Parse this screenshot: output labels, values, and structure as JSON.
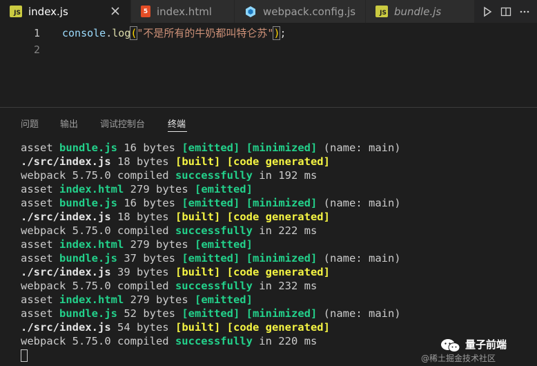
{
  "tabs": [
    {
      "label": "index.js",
      "badge": "JS",
      "badge_bg": "#cbcb41",
      "badge_fg": "#1e1e1e",
      "active": true
    },
    {
      "label": "index.html",
      "badge": "5",
      "badge_bg": "#e44d26",
      "badge_fg": "#ffffff",
      "active": false
    },
    {
      "label": "webpack.config.js",
      "badge": "",
      "badge_bg": "#519aba",
      "badge_fg": "#ffffff",
      "active": false
    },
    {
      "label": "bundle.js",
      "badge": "JS",
      "badge_bg": "#cbcb41",
      "badge_fg": "#1e1e1e",
      "active": false
    }
  ],
  "editor": {
    "lines": [
      {
        "number": "1",
        "obj": "console",
        "dot": ".",
        "fn": "log",
        "open": "(",
        "str": "\"不是所有的牛奶都叫特仑苏\"",
        "close": ")",
        "semi": ";"
      },
      {
        "number": "2"
      }
    ]
  },
  "panel": {
    "tabs": [
      "问题",
      "输出",
      "调试控制台",
      "终端"
    ],
    "active": "终端"
  },
  "terminal": {
    "lines": [
      [
        {
          "t": "asset "
        },
        {
          "t": "bundle.js",
          "c": "green"
        },
        {
          "t": " 16 bytes "
        },
        {
          "t": "[emitted]",
          "c": "green"
        },
        {
          "t": " "
        },
        {
          "t": "[minimized]",
          "c": "green"
        },
        {
          "t": " (name: main)"
        }
      ],
      [
        {
          "t": "./src/index.js",
          "c": "bold"
        },
        {
          "t": " 18 bytes "
        },
        {
          "t": "[built]",
          "c": "yellow"
        },
        {
          "t": " "
        },
        {
          "t": "[code generated]",
          "c": "yellow"
        }
      ],
      [
        {
          "t": "webpack 5.75.0 compiled "
        },
        {
          "t": "successfully",
          "c": "green"
        },
        {
          "t": " in 192 ms"
        }
      ],
      [
        {
          "t": "asset "
        },
        {
          "t": "index.html",
          "c": "green"
        },
        {
          "t": " 279 bytes "
        },
        {
          "t": "[emitted]",
          "c": "green"
        }
      ],
      [
        {
          "t": "asset "
        },
        {
          "t": "bundle.js",
          "c": "green"
        },
        {
          "t": " 16 bytes "
        },
        {
          "t": "[emitted]",
          "c": "green"
        },
        {
          "t": " "
        },
        {
          "t": "[minimized]",
          "c": "green"
        },
        {
          "t": " (name: main)"
        }
      ],
      [
        {
          "t": "./src/index.js",
          "c": "bold"
        },
        {
          "t": " 18 bytes "
        },
        {
          "t": "[built]",
          "c": "yellow"
        },
        {
          "t": " "
        },
        {
          "t": "[code generated]",
          "c": "yellow"
        }
      ],
      [
        {
          "t": "webpack 5.75.0 compiled "
        },
        {
          "t": "successfully",
          "c": "green"
        },
        {
          "t": " in 222 ms"
        }
      ],
      [
        {
          "t": "asset "
        },
        {
          "t": "index.html",
          "c": "green"
        },
        {
          "t": " 279 bytes "
        },
        {
          "t": "[emitted]",
          "c": "green"
        }
      ],
      [
        {
          "t": "asset "
        },
        {
          "t": "bundle.js",
          "c": "green"
        },
        {
          "t": " 37 bytes "
        },
        {
          "t": "[emitted]",
          "c": "green"
        },
        {
          "t": " "
        },
        {
          "t": "[minimized]",
          "c": "green"
        },
        {
          "t": " (name: main)"
        }
      ],
      [
        {
          "t": "./src/index.js",
          "c": "bold"
        },
        {
          "t": " 39 bytes "
        },
        {
          "t": "[built]",
          "c": "yellow"
        },
        {
          "t": " "
        },
        {
          "t": "[code generated]",
          "c": "yellow"
        }
      ],
      [
        {
          "t": "webpack 5.75.0 compiled "
        },
        {
          "t": "successfully",
          "c": "green"
        },
        {
          "t": " in 232 ms"
        }
      ],
      [
        {
          "t": "asset "
        },
        {
          "t": "index.html",
          "c": "green"
        },
        {
          "t": " 279 bytes "
        },
        {
          "t": "[emitted]",
          "c": "green"
        }
      ],
      [
        {
          "t": "asset "
        },
        {
          "t": "bundle.js",
          "c": "green"
        },
        {
          "t": " 52 bytes "
        },
        {
          "t": "[emitted]",
          "c": "green"
        },
        {
          "t": " "
        },
        {
          "t": "[minimized]",
          "c": "green"
        },
        {
          "t": " (name: main)"
        }
      ],
      [
        {
          "t": "./src/index.js",
          "c": "bold"
        },
        {
          "t": " 54 bytes "
        },
        {
          "t": "[built]",
          "c": "yellow"
        },
        {
          "t": " "
        },
        {
          "t": "[code generated]",
          "c": "yellow"
        }
      ],
      [
        {
          "t": "webpack 5.75.0 compiled "
        },
        {
          "t": "successfully",
          "c": "green"
        },
        {
          "t": " in 220 ms"
        }
      ]
    ]
  },
  "watermark": {
    "title": "量子前端",
    "subtitle": "@稀土掘金技术社区"
  },
  "colors": {
    "terminal_green": "#23d18b",
    "terminal_yellow": "#f5f543",
    "editor_bg": "#1e1e1e",
    "tabbar_bg": "#252526"
  },
  "icons": [
    "close-icon",
    "run-icon",
    "split-editor-icon",
    "more-icon",
    "webpack-icon",
    "wechat-icon"
  ]
}
